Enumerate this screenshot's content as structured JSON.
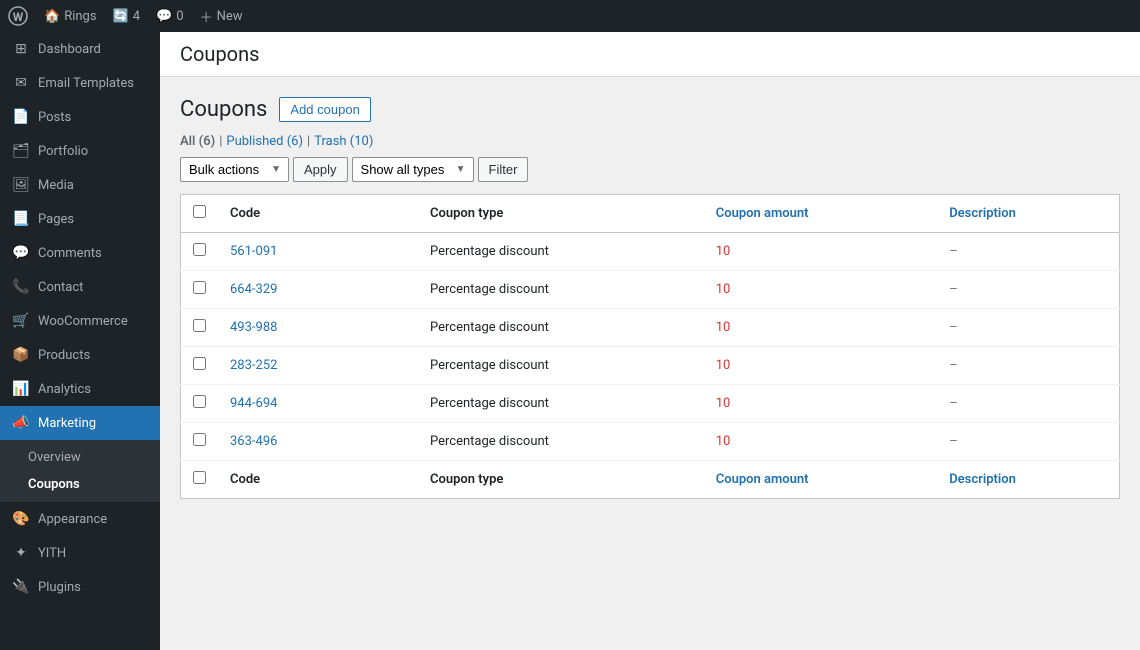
{
  "topbar": {
    "site_name": "Rings",
    "updates_count": "4",
    "comments_count": "0",
    "new_label": "New"
  },
  "sidebar": {
    "items": [
      {
        "id": "dashboard",
        "label": "Dashboard",
        "icon": "⊞"
      },
      {
        "id": "email-templates",
        "label": "Email Templates",
        "icon": "✉"
      },
      {
        "id": "posts",
        "label": "Posts",
        "icon": "📄"
      },
      {
        "id": "portfolio",
        "label": "Portfolio",
        "icon": "🗂"
      },
      {
        "id": "media",
        "label": "Media",
        "icon": "🖼"
      },
      {
        "id": "pages",
        "label": "Pages",
        "icon": "📃"
      },
      {
        "id": "comments",
        "label": "Comments",
        "icon": "💬"
      },
      {
        "id": "contact",
        "label": "Contact",
        "icon": "📞"
      },
      {
        "id": "woocommerce",
        "label": "WooCommerce",
        "icon": "🛒"
      },
      {
        "id": "products",
        "label": "Products",
        "icon": "📦"
      },
      {
        "id": "analytics",
        "label": "Analytics",
        "icon": "📊"
      },
      {
        "id": "marketing",
        "label": "Marketing",
        "icon": "📣",
        "active": true
      },
      {
        "id": "appearance",
        "label": "Appearance",
        "icon": "🎨"
      },
      {
        "id": "yith",
        "label": "YITH",
        "icon": "✦"
      },
      {
        "id": "plugins",
        "label": "Plugins",
        "icon": "🔌"
      }
    ],
    "sub_items": [
      {
        "id": "overview",
        "label": "Overview"
      },
      {
        "id": "coupons",
        "label": "Coupons",
        "active": true
      }
    ]
  },
  "page": {
    "breadcrumb": "Coupons",
    "title": "Coupons",
    "add_button": "Add coupon",
    "filters": {
      "all_label": "All",
      "all_count": "(6)",
      "published_label": "Published",
      "published_count": "(6)",
      "trash_label": "Trash",
      "trash_count": "(10)",
      "bulk_actions_label": "Bulk actions",
      "apply_label": "Apply",
      "show_all_types_label": "Show all types",
      "filter_label": "Filter"
    },
    "table": {
      "headers": [
        "Code",
        "Coupon type",
        "Coupon amount",
        "Description"
      ],
      "rows": [
        {
          "code": "561-091",
          "type": "Percentage discount",
          "amount": "10",
          "description": "–"
        },
        {
          "code": "664-329",
          "type": "Percentage discount",
          "amount": "10",
          "description": "–"
        },
        {
          "code": "493-988",
          "type": "Percentage discount",
          "amount": "10",
          "description": "–"
        },
        {
          "code": "283-252",
          "type": "Percentage discount",
          "amount": "10",
          "description": "–"
        },
        {
          "code": "944-694",
          "type": "Percentage discount",
          "amount": "10",
          "description": "–"
        },
        {
          "code": "363-496",
          "type": "Percentage discount",
          "amount": "10",
          "description": "–"
        }
      ],
      "footer_headers": [
        "Code",
        "Coupon type",
        "Coupon amount",
        "Description"
      ]
    }
  },
  "colors": {
    "accent": "#2271b1",
    "amount": "#d63638",
    "sidebar_bg": "#1d2327",
    "sidebar_active": "#2271b1"
  }
}
